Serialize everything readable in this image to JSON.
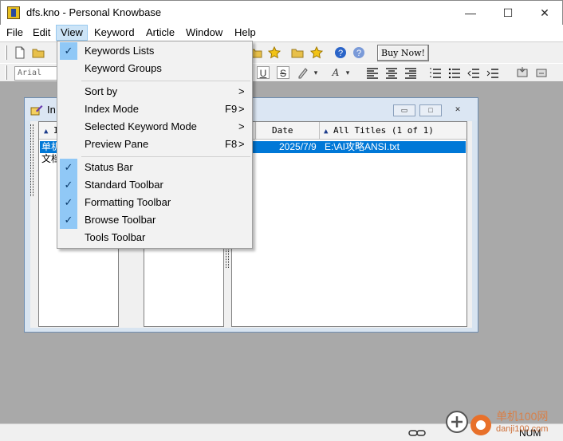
{
  "window": {
    "title": "dfs.kno - Personal Knowbase",
    "minimize_glyph": "—",
    "maximize_glyph": "☐",
    "close_glyph": "✕"
  },
  "menubar": {
    "items": [
      {
        "label": "File"
      },
      {
        "label": "Edit"
      },
      {
        "label": "View"
      },
      {
        "label": "Keyword"
      },
      {
        "label": "Article"
      },
      {
        "label": "Window"
      },
      {
        "label": "Help"
      }
    ]
  },
  "toolbar": {
    "buy_now": "Buy Now!",
    "font": "Arial",
    "underline": "U",
    "strike": "S",
    "italic_a": "A",
    "dropdown_arrow": "▾"
  },
  "view_menu": {
    "items": [
      {
        "label": "Keywords Lists",
        "checked": true,
        "shortcut": "",
        "submenu": false
      },
      {
        "label": "Keyword Groups",
        "checked": false,
        "shortcut": "",
        "submenu": false
      },
      {
        "label": "Sort by",
        "checked": false,
        "shortcut": "",
        "submenu": true
      },
      {
        "label": "Index Mode",
        "checked": false,
        "shortcut": "F9",
        "submenu": true
      },
      {
        "label": "Selected Keyword Mode",
        "checked": false,
        "shortcut": "",
        "submenu": true
      },
      {
        "label": "Preview Pane",
        "checked": false,
        "shortcut": "F8",
        "submenu": true
      },
      {
        "label": "Status Bar",
        "checked": true,
        "shortcut": "",
        "submenu": false
      },
      {
        "label": "Standard Toolbar",
        "checked": true,
        "shortcut": "",
        "submenu": false
      },
      {
        "label": "Formatting Toolbar",
        "checked": true,
        "shortcut": "",
        "submenu": false
      },
      {
        "label": "Browse Toolbar",
        "checked": true,
        "shortcut": "",
        "submenu": false
      },
      {
        "label": "Tools Toolbar",
        "checked": false,
        "shortcut": "",
        "submenu": false
      }
    ],
    "check_glyph": "✓",
    "arrow_glyph": ">"
  },
  "child_window": {
    "title_partial": "In",
    "min_glyph": "▭",
    "max_glyph": "□",
    "close_glyph": "✕"
  },
  "index_panel": {
    "header_arrow": "▲",
    "header_partial": "I",
    "rows": [
      "单机",
      "文档"
    ]
  },
  "articles": {
    "headers": {
      "date": "Date",
      "titles": "All Titles (1 of 1)",
      "attach_partial": ")",
      "sort_arrow": "▲"
    },
    "rows": [
      {
        "date": "2025/7/9",
        "title": "E:\\AI攻略ANSI.txt"
      }
    ]
  },
  "statusbar": {
    "num": "NUM"
  },
  "watermark": {
    "text": "单机100网",
    "subtext": "danji100.com"
  },
  "colors": {
    "selection": "#0078d7",
    "menu_highlight": "#cce4f7",
    "check_bg": "#90c8f6",
    "client_bg": "#a9a9a9",
    "star": "#f2c316"
  }
}
